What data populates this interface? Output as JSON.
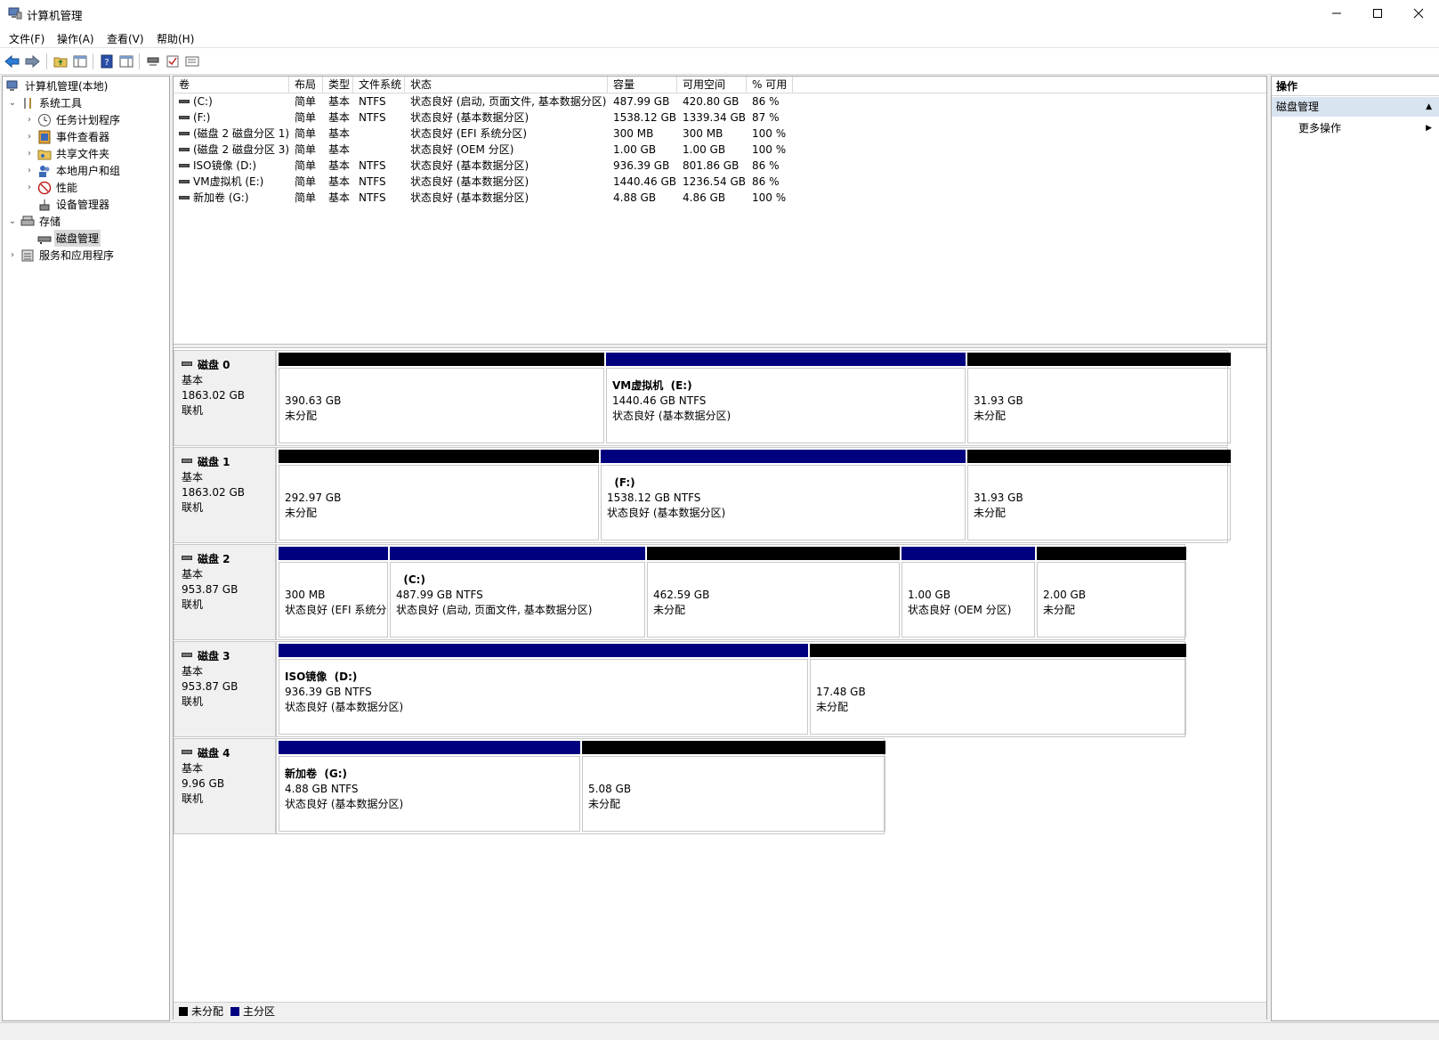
{
  "window": {
    "title": "计算机管理"
  },
  "menu": [
    "文件(F)",
    "操作(A)",
    "查看(V)",
    "帮助(H)"
  ],
  "toolbar_icons": [
    "back-arrow-icon",
    "forward-arrow-icon",
    "up-folder-icon",
    "show-hide-tree-icon",
    "help-icon",
    "properties-pane-icon",
    "connect-icon",
    "check-icon",
    "list-icon"
  ],
  "tree": {
    "root": "计算机管理(本地)",
    "system_tools": "系统工具",
    "task_scheduler": "任务计划程序",
    "event_viewer": "事件查看器",
    "shared_folders": "共享文件夹",
    "local_users": "本地用户和组",
    "performance": "性能",
    "device_manager": "设备管理器",
    "storage": "存储",
    "disk_management": "磁盘管理",
    "services_apps": "服务和应用程序"
  },
  "volume_columns": [
    "卷",
    "布局",
    "类型",
    "文件系统",
    "状态",
    "容量",
    "可用空间",
    "% 可用"
  ],
  "volumes": [
    {
      "name": "(C:)",
      "layout": "简单",
      "type": "基本",
      "fs": "NTFS",
      "status": "状态良好 (启动, 页面文件, 基本数据分区)",
      "capacity": "487.99 GB",
      "free": "420.80 GB",
      "pct": "86 %"
    },
    {
      "name": "(F:)",
      "layout": "简单",
      "type": "基本",
      "fs": "NTFS",
      "status": "状态良好 (基本数据分区)",
      "capacity": "1538.12 GB",
      "free": "1339.34 GB",
      "pct": "87 %"
    },
    {
      "name": "(磁盘 2 磁盘分区 1)",
      "layout": "简单",
      "type": "基本",
      "fs": "",
      "status": "状态良好 (EFI 系统分区)",
      "capacity": "300 MB",
      "free": "300 MB",
      "pct": "100 %"
    },
    {
      "name": "(磁盘 2 磁盘分区 3)",
      "layout": "简单",
      "type": "基本",
      "fs": "",
      "status": "状态良好 (OEM 分区)",
      "capacity": "1.00 GB",
      "free": "1.00 GB",
      "pct": "100 %"
    },
    {
      "name": "ISO镜像 (D:)",
      "layout": "简单",
      "type": "基本",
      "fs": "NTFS",
      "status": "状态良好 (基本数据分区)",
      "capacity": "936.39 GB",
      "free": "801.86 GB",
      "pct": "86 %"
    },
    {
      "name": "VM虚拟机 (E:)",
      "layout": "简单",
      "type": "基本",
      "fs": "NTFS",
      "status": "状态良好 (基本数据分区)",
      "capacity": "1440.46 GB",
      "free": "1236.54 GB",
      "pct": "86 %"
    },
    {
      "name": "新加卷 (G:)",
      "layout": "简单",
      "type": "基本",
      "fs": "NTFS",
      "status": "状态良好 (基本数据分区)",
      "capacity": "4.88 GB",
      "free": "4.86 GB",
      "pct": "100 %"
    }
  ],
  "disks": [
    {
      "name": "磁盘 0",
      "type": "基本",
      "size": "1863.02 GB",
      "state": "联机",
      "partitions": [
        {
          "kind": "unallocated",
          "name": "",
          "size": "390.63 GB",
          "status": "未分配"
        },
        {
          "kind": "primary",
          "name": "VM虚拟机  (E:)",
          "size": "1440.46 GB NTFS",
          "status": "状态良好 (基本数据分区)"
        },
        {
          "kind": "unallocated",
          "name": "",
          "size": "31.93 GB",
          "status": "未分配"
        }
      ]
    },
    {
      "name": "磁盘 1",
      "type": "基本",
      "size": "1863.02 GB",
      "state": "联机",
      "partitions": [
        {
          "kind": "unallocated",
          "name": "",
          "size": "292.97 GB",
          "status": "未分配"
        },
        {
          "kind": "primary",
          "name": "  (F:)",
          "size": "1538.12 GB NTFS",
          "status": "状态良好 (基本数据分区)"
        },
        {
          "kind": "unallocated",
          "name": "",
          "size": "31.93 GB",
          "status": "未分配"
        }
      ]
    },
    {
      "name": "磁盘 2",
      "type": "基本",
      "size": "953.87 GB",
      "state": "联机",
      "partitions": [
        {
          "kind": "primary",
          "name": "",
          "size": "300 MB",
          "status": "状态良好 (EFI 系统分"
        },
        {
          "kind": "primary",
          "name": "  (C:)",
          "size": "487.99 GB NTFS",
          "status": "状态良好 (启动, 页面文件, 基本数据分区)"
        },
        {
          "kind": "unallocated",
          "name": "",
          "size": "462.59 GB",
          "status": "未分配"
        },
        {
          "kind": "primary",
          "name": "",
          "size": "1.00 GB",
          "status": "状态良好 (OEM 分区)"
        },
        {
          "kind": "unallocated",
          "name": "",
          "size": "2.00 GB",
          "status": "未分配"
        }
      ]
    },
    {
      "name": "磁盘 3",
      "type": "基本",
      "size": "953.87 GB",
      "state": "联机",
      "partitions": [
        {
          "kind": "primary",
          "name": "ISO镜像  (D:)",
          "size": "936.39 GB NTFS",
          "status": "状态良好 (基本数据分区)"
        },
        {
          "kind": "unallocated",
          "name": "",
          "size": "17.48 GB",
          "status": "未分配"
        }
      ]
    },
    {
      "name": "磁盘 4",
      "type": "基本",
      "size": "9.96 GB",
      "state": "联机",
      "partitions": [
        {
          "kind": "primary",
          "name": "新加卷  (G:)",
          "size": "4.88 GB NTFS",
          "status": "状态良好 (基本数据分区)"
        },
        {
          "kind": "unallocated",
          "name": "",
          "size": "5.08 GB",
          "status": "未分配"
        }
      ]
    }
  ],
  "legend": {
    "unallocated": "未分配",
    "primary": "主分区"
  },
  "colors": {
    "unallocated": "#000000",
    "primary": "#00007f",
    "selection": "#d9e4f1"
  },
  "actions": {
    "header": "操作",
    "section": "磁盘管理",
    "more": "更多操作"
  }
}
